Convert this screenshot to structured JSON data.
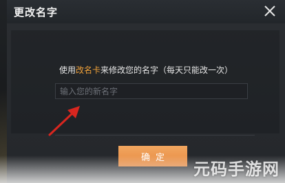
{
  "dialog": {
    "title": "更改名字",
    "close_icon": "close-icon",
    "hint_prefix": "使用",
    "hint_card": "改名卡",
    "hint_suffix": "来修改您的名字（每天只能改一次）",
    "input_value": "",
    "input_placeholder": "输入您的新名字",
    "confirm_label": "确定"
  },
  "watermark": {
    "text": "元码手游网"
  },
  "colors": {
    "title_bar": "#2a2e33",
    "panel": "#2a2d31",
    "highlight": "#f0a13a",
    "confirm_button": "#e88a40",
    "arrow": "#d8261f"
  }
}
